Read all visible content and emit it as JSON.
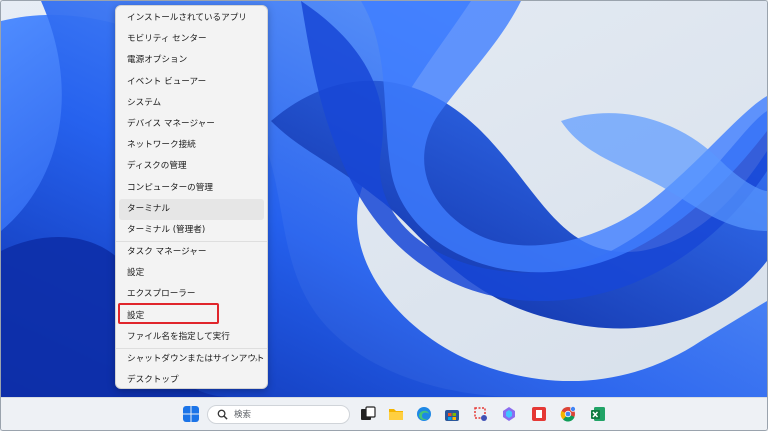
{
  "context_menu": {
    "items": [
      {
        "label": "インストールされているアプリ"
      },
      {
        "label": "モビリティ センター"
      },
      {
        "label": "電源オプション"
      },
      {
        "label": "イベント ビューアー"
      },
      {
        "label": "システム"
      },
      {
        "label": "デバイス マネージャー"
      },
      {
        "label": "ネットワーク接続"
      },
      {
        "label": "ディスクの管理"
      },
      {
        "label": "コンピューターの管理"
      },
      {
        "label": "ターミナル"
      },
      {
        "label": "ターミナル (管理者)"
      },
      {
        "label": "タスク マネージャー"
      },
      {
        "label": "設定"
      },
      {
        "label": "エクスプローラー"
      },
      {
        "label": "設定"
      },
      {
        "label": "ファイル名を指定して実行"
      },
      {
        "label": "シャットダウンまたはサインアウト"
      },
      {
        "label": "デスクトップ"
      }
    ],
    "submenu_chevron": "›"
  },
  "taskbar": {
    "search_placeholder": "検索",
    "icons": [
      "windows-start-icon",
      "search-icon",
      "task-view-icon",
      "file-explorer-icon",
      "edge-icon",
      "store-icon",
      "snipping-tool-icon",
      "copilot-icon",
      "app-icon",
      "chrome-icon",
      "excel-icon"
    ]
  },
  "colors": {
    "highlight_box": "#e0252b",
    "wallpaper_blue": "#1e5be8",
    "menu_bg": "#f3f3f3"
  }
}
